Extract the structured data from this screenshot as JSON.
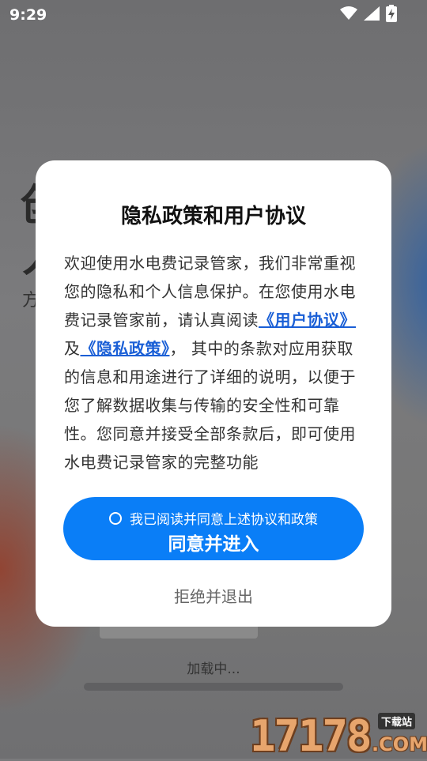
{
  "status_bar": {
    "time": "9:29",
    "icons": [
      "wifi-icon",
      "signal-icon",
      "battery-charging-icon"
    ]
  },
  "background": {
    "text_line_1": "创",
    "text_line_2": "人",
    "text_line_3": "方",
    "loading_text": "加载中..."
  },
  "dialog": {
    "title": "隐私政策和用户协议",
    "body_part_1": "欢迎使用水电费记录管家，我们非常重视您的隐私和个人信息保护。在您使用水电费记录管家前，请认真阅读",
    "user_agreement_link": "《用户协议》",
    "body_and": "及",
    "privacy_policy_link": "《隐私政策》",
    "body_part_2": "， 其中的条款对应用获取的信息和用途进行了详细的说明，以便于您了解数据收集与传输的安全性和可靠性。您同意并接受全部条款后，即可使用水电费记录管家的完整功能",
    "checkbox_label": "我已阅读并同意上述协议和政策",
    "agree_button": "同意并进入",
    "reject_button": "拒绝并退出"
  },
  "watermark": {
    "number": "17178",
    "site_label": "下载站",
    "domain": ".COM"
  },
  "colors": {
    "primary": "#0a7ef7",
    "link": "#1a5fd6",
    "overlay": "#7a7a7c"
  }
}
